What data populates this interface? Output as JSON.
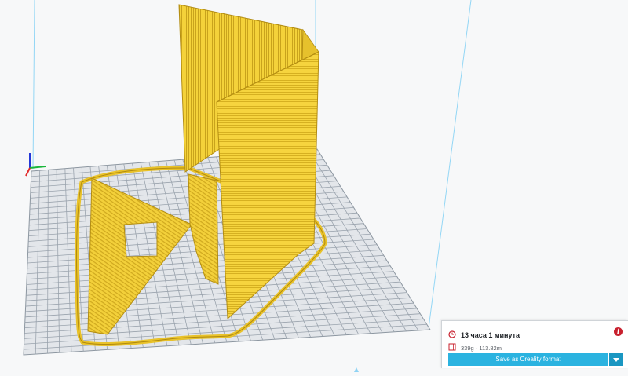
{
  "print_info": {
    "time": "13 часа 1 минута",
    "material": "339g · 113.82m",
    "save_button_label": "Save as Creality format"
  },
  "icons": {
    "clock": "clock-icon",
    "filament": "filament-spool-icon",
    "info": "info-icon",
    "dropdown": "chevron-down-icon",
    "axes": "axis-gizmo-icon"
  },
  "colors": {
    "model_yellow": "#f5d23b",
    "model_shade": "#d8b21e",
    "build_plate": "#e3e6ea",
    "grid_line": "#9da5ae",
    "build_volume_edge": "#8fd3f4",
    "primary_button": "#2bb3e0",
    "info_red": "#c8202e"
  }
}
